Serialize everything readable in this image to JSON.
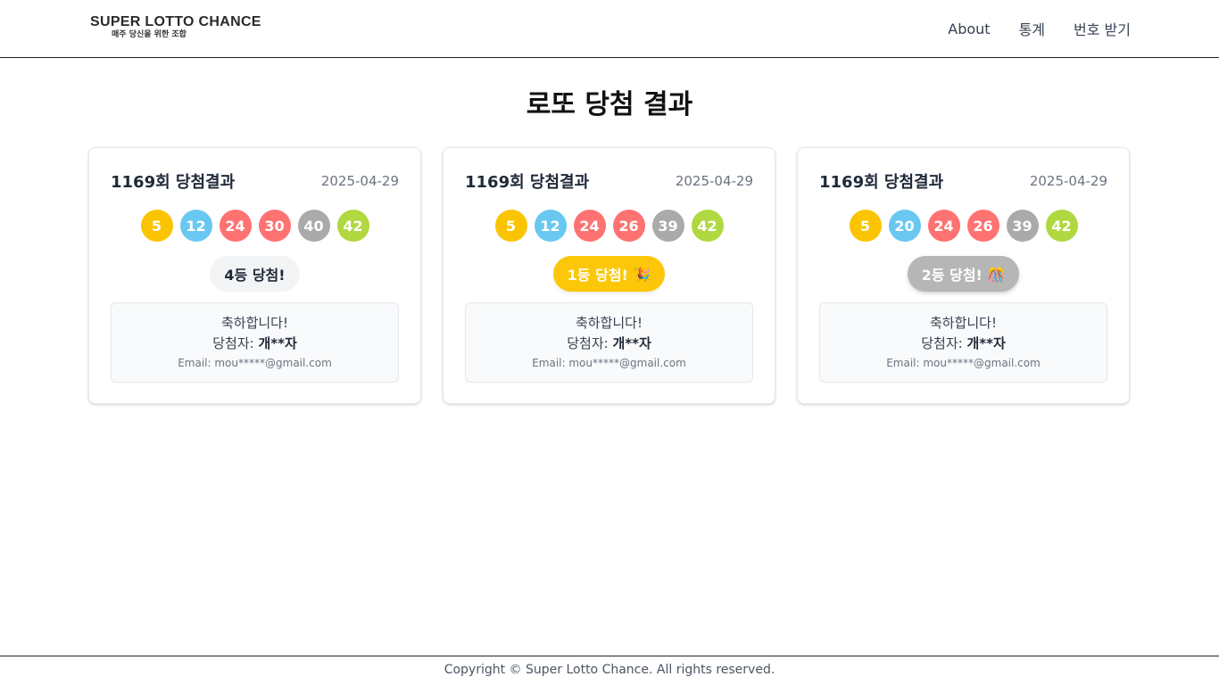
{
  "header": {
    "logo_main": "SUPER LOTTO CHANCE",
    "logo_sub": "매주 당신을 위한 조합",
    "nav": [
      "About",
      "통계",
      "번호 받기"
    ]
  },
  "page_title": "로또 당첨 결과",
  "cards": [
    {
      "title": "1169회 당첨결과",
      "date": "2025-04-29",
      "balls": [
        {
          "num": "5",
          "color": "#fbc400"
        },
        {
          "num": "12",
          "color": "#69c8f2"
        },
        {
          "num": "24",
          "color": "#ff7272"
        },
        {
          "num": "30",
          "color": "#ff7272"
        },
        {
          "num": "40",
          "color": "#aaaaaa"
        },
        {
          "num": "42",
          "color": "#b0d840"
        }
      ],
      "badge": "4등 당첨!",
      "badge_style": "rank4",
      "congrats": "축하합니다!",
      "winner_label": "당첨자: ",
      "winner_name": "개**자",
      "email": "Email: mou*****@gmail.com"
    },
    {
      "title": "1169회 당첨결과",
      "date": "2025-04-29",
      "balls": [
        {
          "num": "5",
          "color": "#fbc400"
        },
        {
          "num": "12",
          "color": "#69c8f2"
        },
        {
          "num": "24",
          "color": "#ff7272"
        },
        {
          "num": "26",
          "color": "#ff7272"
        },
        {
          "num": "39",
          "color": "#aaaaaa"
        },
        {
          "num": "42",
          "color": "#b0d840"
        }
      ],
      "badge": "1등 당첨! 🎉",
      "badge_style": "rank1",
      "congrats": "축하합니다!",
      "winner_label": "당첨자: ",
      "winner_name": "개**자",
      "email": "Email: mou*****@gmail.com"
    },
    {
      "title": "1169회 당첨결과",
      "date": "2025-04-29",
      "balls": [
        {
          "num": "5",
          "color": "#fbc400"
        },
        {
          "num": "20",
          "color": "#69c8f2"
        },
        {
          "num": "24",
          "color": "#ff7272"
        },
        {
          "num": "26",
          "color": "#ff7272"
        },
        {
          "num": "39",
          "color": "#aaaaaa"
        },
        {
          "num": "42",
          "color": "#b0d840"
        }
      ],
      "badge": "2등 당첨! 🎊",
      "badge_style": "rank2",
      "congrats": "축하합니다!",
      "winner_label": "당첨자: ",
      "winner_name": "개**자",
      "email": "Email: mou*****@gmail.com"
    }
  ],
  "footer": "Copyright © Super Lotto Chance. All rights reserved."
}
